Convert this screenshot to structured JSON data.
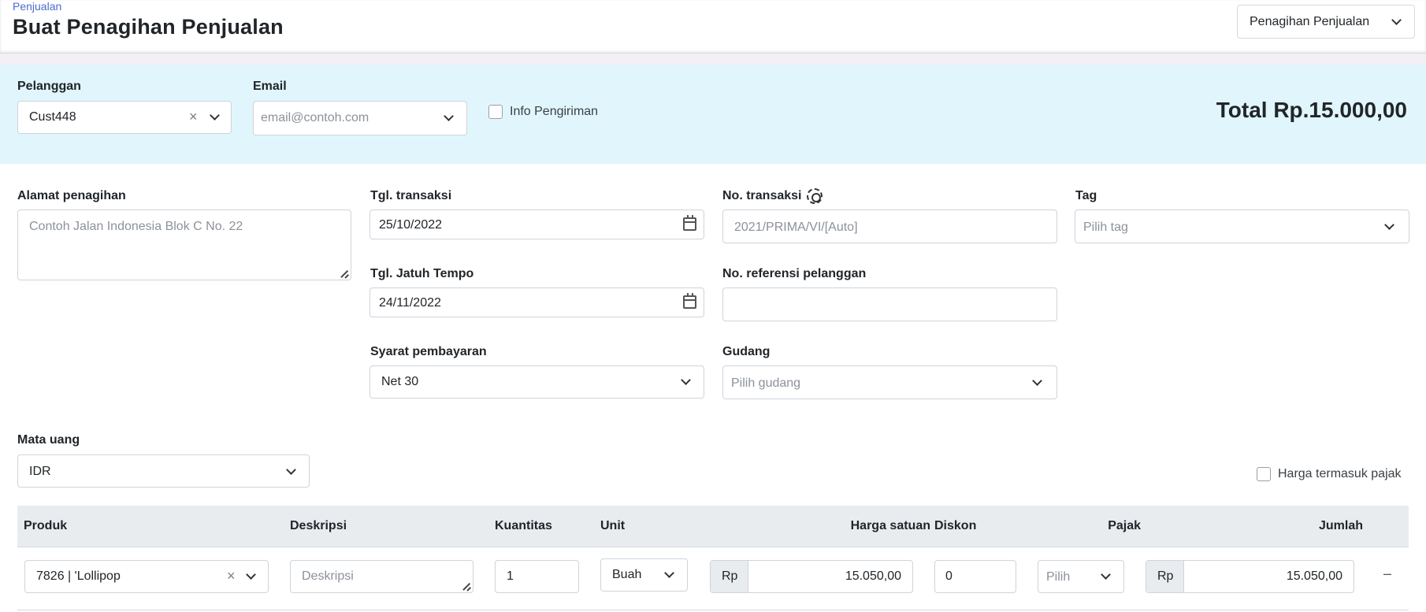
{
  "header": {
    "breadcrumb": "Penjualan",
    "title": "Buat Penagihan Penjualan",
    "type_selector": "Penagihan Penjualan"
  },
  "customer_band": {
    "customer_label": "Pelanggan",
    "customer_value": "Cust448",
    "email_label": "Email",
    "email_placeholder": "email@contoh.com",
    "shipping_info_label": "Info Pengiriman",
    "total_text": "Total Rp.15.000,00"
  },
  "form": {
    "billing_address_label": "Alamat penagihan",
    "billing_address_placeholder": "Contoh Jalan Indonesia Blok C No. 22",
    "transaction_date_label": "Tgl. transaksi",
    "transaction_date_value": "25/10/2022",
    "due_date_label": "Tgl. Jatuh Tempo",
    "due_date_value": "24/11/2022",
    "payment_terms_label": "Syarat pembayaran",
    "payment_terms_value": "Net 30",
    "transaction_no_label": "No. transaksi",
    "transaction_no_placeholder": "2021/PRIMA/VI/[Auto]",
    "customer_ref_label": "No. referensi pelanggan",
    "customer_ref_value": "",
    "warehouse_label": "Gudang",
    "warehouse_placeholder": "Pilih gudang",
    "tag_label": "Tag",
    "tag_placeholder": "Pilih tag",
    "currency_label": "Mata uang",
    "currency_value": "IDR",
    "tax_inclusive_label": "Harga termasuk pajak"
  },
  "table": {
    "headers": {
      "product": "Produk",
      "description": "Deskripsi",
      "quantity": "Kuantitas",
      "unit": "Unit",
      "unit_price": "Harga satuan",
      "discount": "Diskon",
      "tax": "Pajak",
      "amount": "Jumlah"
    },
    "rows": [
      {
        "product": "7826 | 'Lollipop",
        "description_placeholder": "Deskripsi",
        "quantity": "1",
        "unit": "Buah",
        "currency_prefix": "Rp",
        "unit_price": "15.050,00",
        "discount": "0",
        "tax_placeholder": "Pilih",
        "amount": "15.050,00",
        "remove_symbol": "–"
      }
    ]
  }
}
